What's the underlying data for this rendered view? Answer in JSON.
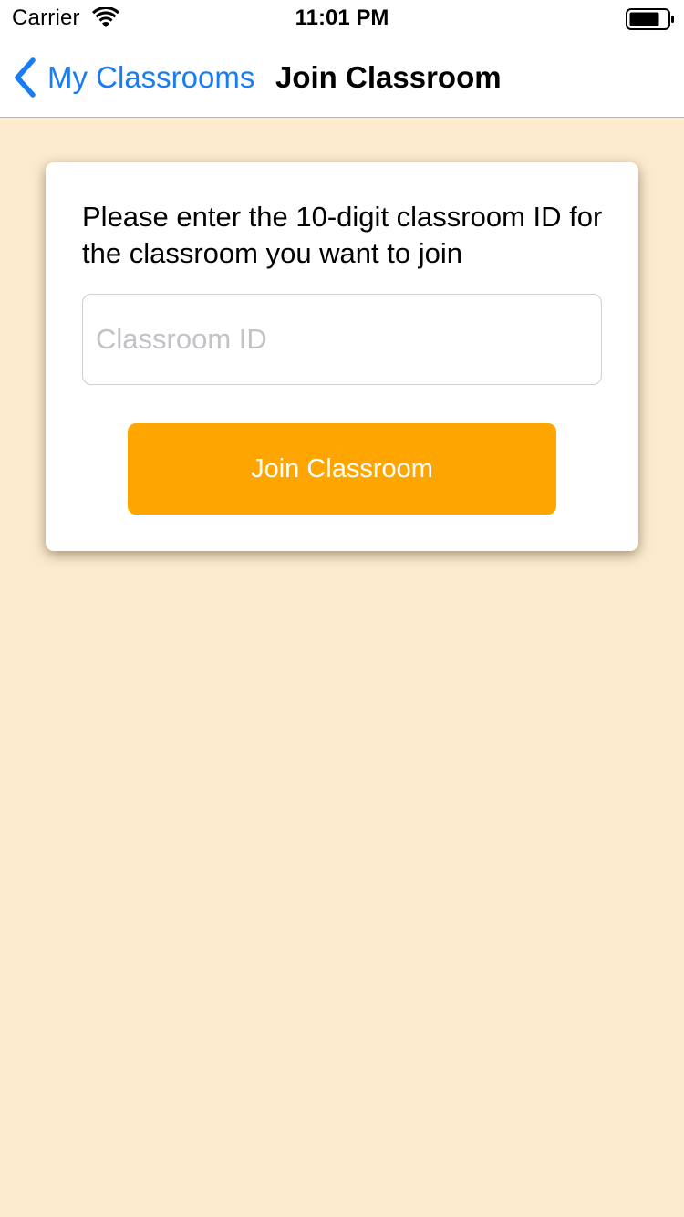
{
  "status_bar": {
    "carrier": "Carrier",
    "time": "11:01 PM",
    "icons": [
      "wifi-icon",
      "battery-icon"
    ]
  },
  "nav": {
    "back_label": "My Classrooms",
    "title": "Join Classroom",
    "back_icon": "chevron-left-icon"
  },
  "card": {
    "instruction": "Please enter the 10-digit classroom ID for the classroom you want to join",
    "input": {
      "value": "",
      "placeholder": "Classroom ID"
    },
    "button_label": "Join Classroom"
  },
  "colors": {
    "background": "#FDEBCF",
    "accent_blue": "#1A7CF5",
    "button_orange": "#FFA500",
    "card": "#FFFFFF",
    "placeholder": "#C2C2C7"
  }
}
